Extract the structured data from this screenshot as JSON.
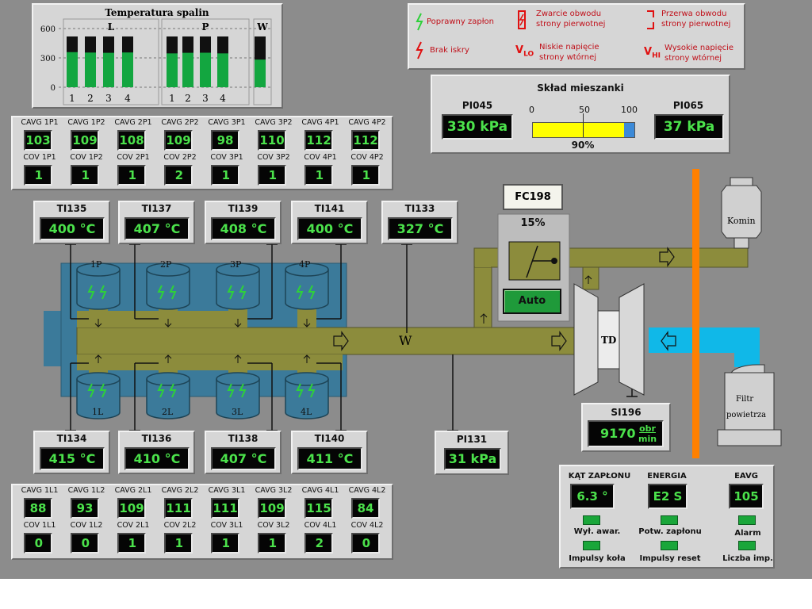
{
  "chart_data": {
    "type": "bar",
    "title": "Temperatura spalin",
    "groups": [
      "L",
      "P",
      "W"
    ],
    "categories": [
      "1",
      "2",
      "3",
      "4",
      "1",
      "2",
      "3",
      "4",
      ""
    ],
    "ylim": [
      0,
      600
    ],
    "yticks": [
      "600",
      "300",
      "0"
    ],
    "values": [
      415,
      410,
      407,
      411,
      400,
      407,
      408,
      400,
      327
    ]
  },
  "legend": {
    "items": [
      {
        "text": "Poprawny zapłon",
        "icon": "green-spark-icon"
      },
      {
        "text": "Brak iskry",
        "icon": "red-spark-icon"
      },
      {
        "text": "Zwarcie obwodu strony pierwotnej",
        "icon": "short-circuit-icon"
      },
      {
        "text": "Niskie napięcie strony wtórnej",
        "icon": "vlo-icon",
        "symbol": "V",
        "sub": "LO"
      },
      {
        "text": "Przerwa obwodu strony pierwotnej",
        "icon": "open-circuit-icon"
      },
      {
        "text": "Wysokie napięcie strony wtórnej",
        "icon": "vhi-icon",
        "symbol": "V",
        "sub": "HI"
      }
    ]
  },
  "mix": {
    "title": "Skład mieszanki",
    "pi045": {
      "tag": "PI045",
      "value": "330 kPa"
    },
    "pi065": {
      "tag": "PI065",
      "value": "37 kPa"
    },
    "scale": [
      "0",
      "50",
      "100"
    ],
    "percent": 90,
    "percent_label": "90%"
  },
  "cavg_p": {
    "labels": [
      "CAVG 1P1",
      "CAVG 1P2",
      "CAVG 2P1",
      "CAVG 2P2",
      "CAVG 3P1",
      "CAVG 3P2",
      "CAVG 4P1",
      "CAVG 4P2"
    ],
    "values": [
      "103",
      "109",
      "108",
      "109",
      "98",
      "110",
      "112",
      "112"
    ],
    "cov_labels": [
      "COV 1P1",
      "COV 1P2",
      "COV 2P1",
      "COV 2P2",
      "COV 3P1",
      "COV 3P2",
      "COV 4P1",
      "COV 4P2"
    ],
    "cov_values": [
      "1",
      "1",
      "1",
      "2",
      "1",
      "1",
      "1",
      "1"
    ]
  },
  "cavg_l": {
    "labels": [
      "CAVG 1L1",
      "CAVG 1L2",
      "CAVG 2L1",
      "CAVG 2L2",
      "CAVG 3L1",
      "CAVG 3L2",
      "CAVG 4L1",
      "CAVG 4L2"
    ],
    "values": [
      "88",
      "93",
      "109",
      "111",
      "111",
      "109",
      "115",
      "84"
    ],
    "cov_labels": [
      "COV 1L1",
      "COV 1L2",
      "COV 2L1",
      "COV 2L2",
      "COV 3L1",
      "COV 3L2",
      "COV 4L1",
      "COV 4L2"
    ],
    "cov_values": [
      "0",
      "0",
      "1",
      "1",
      "1",
      "1",
      "2",
      "0"
    ]
  },
  "ti_top": [
    {
      "tag": "TI135",
      "value": "400 °C"
    },
    {
      "tag": "TI137",
      "value": "407 °C"
    },
    {
      "tag": "TI139",
      "value": "408 °C"
    },
    {
      "tag": "TI141",
      "value": "400 °C"
    },
    {
      "tag": "TI133",
      "value": "327 °C"
    }
  ],
  "ti_bottom": [
    {
      "tag": "TI134",
      "value": "415 °C"
    },
    {
      "tag": "TI136",
      "value": "410 °C"
    },
    {
      "tag": "TI138",
      "value": "407 °C"
    },
    {
      "tag": "TI140",
      "value": "411 °C"
    }
  ],
  "pi131": {
    "tag": "PI131",
    "value": "31 kPa"
  },
  "si196": {
    "tag": "SI196",
    "value": "9170",
    "unit_top": "obr",
    "unit_bottom": "min"
  },
  "fc198": {
    "tag": "FC198",
    "value": "15%",
    "mode": "Auto"
  },
  "cylinders": {
    "top": [
      "1P",
      "2P",
      "3P",
      "4P"
    ],
    "bottom": [
      "1L",
      "2L",
      "3L",
      "4L"
    ]
  },
  "labels": {
    "w": "W",
    "td": "TD",
    "komin": "Komin",
    "filtr1": "Filtr",
    "filtr2": "powietrza"
  },
  "status": {
    "kat_title": "KĄT ZAPŁONU",
    "kat_value": "6.3 °",
    "energia_title": "ENERGIA",
    "energia_value": "E2 S",
    "eavg_title": "EAVG",
    "eavg_value": "105",
    "leds": [
      "Wył. awar.",
      "Potw. zapłonu",
      "Alarm",
      "Impulsy koła",
      "Impulsy reset",
      "Liczba imp."
    ]
  },
  "colors": {
    "pipe": "#8c8c3c",
    "engine": "#3b7a9a",
    "spark": "#2ed03a",
    "bar": "#13a640",
    "air": "#10b8e8",
    "stack": "#ff8000",
    "mixbar": "#ffff00"
  }
}
